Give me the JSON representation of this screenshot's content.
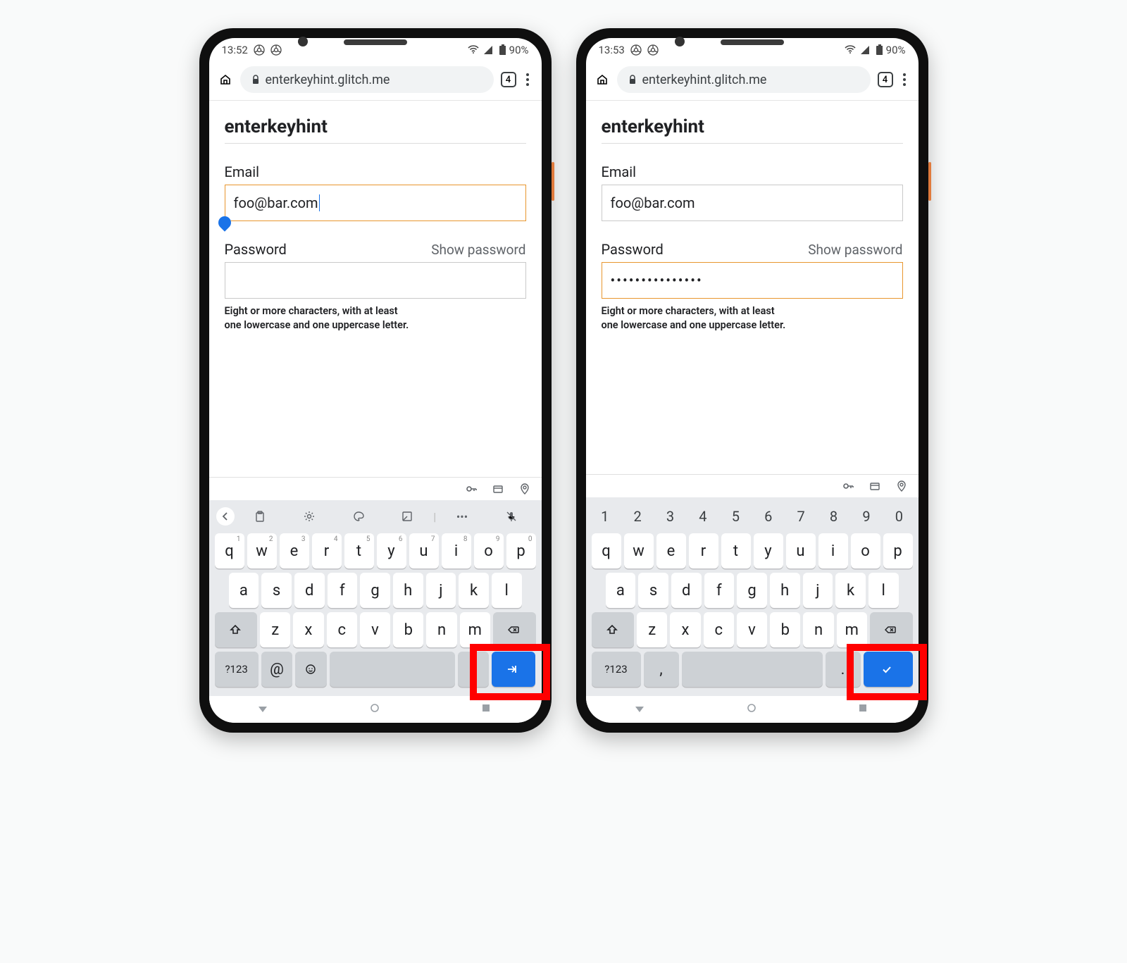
{
  "phones": [
    {
      "status": {
        "time": "13:52",
        "battery": "90%"
      },
      "url": "enterkeyhint.glitch.me",
      "tab_count": "4",
      "page_title": "enterkeyhint",
      "email": {
        "label": "Email",
        "value": "foo@bar.com",
        "focused": true
      },
      "password": {
        "label": "Password",
        "show": "Show password",
        "value": "",
        "focused": false
      },
      "hint_l1": "Eight or more characters, with at least",
      "hint_l2": "one lowercase and one uppercase letter.",
      "keyboard": {
        "toolbar_mode": "icons",
        "row_top": [
          {
            "k": "q",
            "s": "1"
          },
          {
            "k": "w",
            "s": "2"
          },
          {
            "k": "e",
            "s": "3"
          },
          {
            "k": "r",
            "s": "4"
          },
          {
            "k": "t",
            "s": "5"
          },
          {
            "k": "y",
            "s": "6"
          },
          {
            "k": "u",
            "s": "7"
          },
          {
            "k": "i",
            "s": "8"
          },
          {
            "k": "o",
            "s": "9"
          },
          {
            "k": "p",
            "s": "0"
          }
        ],
        "row_mid": [
          "a",
          "s",
          "d",
          "f",
          "g",
          "h",
          "j",
          "k",
          "l"
        ],
        "row_bot": [
          "z",
          "x",
          "c",
          "v",
          "b",
          "n",
          "m"
        ],
        "sym_label": "?123",
        "extra1": "@",
        "extra2": ".",
        "enter_kind": "next"
      }
    },
    {
      "status": {
        "time": "13:53",
        "battery": "90%"
      },
      "url": "enterkeyhint.glitch.me",
      "tab_count": "4",
      "page_title": "enterkeyhint",
      "email": {
        "label": "Email",
        "value": "foo@bar.com",
        "focused": false
      },
      "password": {
        "label": "Password",
        "show": "Show password",
        "value": "•••••••••••••••",
        "focused": true
      },
      "hint_l1": "Eight or more characters, with at least",
      "hint_l2": "one lowercase and one uppercase letter.",
      "keyboard": {
        "toolbar_mode": "numbers",
        "numbers": [
          "1",
          "2",
          "3",
          "4",
          "5",
          "6",
          "7",
          "8",
          "9",
          "0"
        ],
        "row_top": [
          {
            "k": "q"
          },
          {
            "k": "w"
          },
          {
            "k": "e"
          },
          {
            "k": "r"
          },
          {
            "k": "t"
          },
          {
            "k": "y"
          },
          {
            "k": "u"
          },
          {
            "k": "i"
          },
          {
            "k": "o"
          },
          {
            "k": "p"
          }
        ],
        "row_mid": [
          "a",
          "s",
          "d",
          "f",
          "g",
          "h",
          "j",
          "k",
          "l"
        ],
        "row_bot": [
          "z",
          "x",
          "c",
          "v",
          "b",
          "n",
          "m"
        ],
        "sym_label": "?123",
        "extra1": ",",
        "extra2": ".",
        "enter_kind": "done"
      }
    }
  ]
}
